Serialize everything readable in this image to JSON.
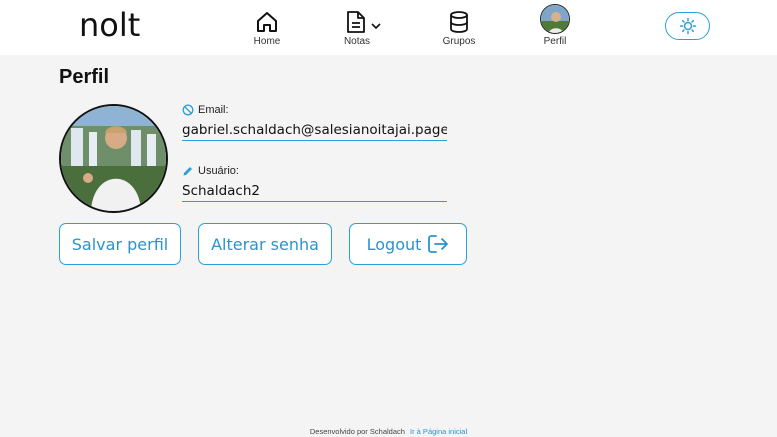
{
  "app": {
    "logo": "nolt"
  },
  "nav": {
    "items": [
      {
        "label": "Home",
        "icon": "home-icon"
      },
      {
        "label": "Notas",
        "icon": "document-icon"
      },
      {
        "label": "Grupos",
        "icon": "database-icon"
      },
      {
        "label": "Perfil",
        "icon": "avatar"
      }
    ]
  },
  "theme_toggle": {
    "icon": "sun-icon"
  },
  "page": {
    "title": "Perfil"
  },
  "profile": {
    "email": {
      "label": "Email:",
      "value": "gabriel.schaldach@salesianoitajai.page",
      "icon": "disabled-icon"
    },
    "username": {
      "label": "Usuário:",
      "value": "Schaldach2",
      "icon": "pencil-icon"
    }
  },
  "actions": {
    "save": "Salvar perfil",
    "change_password": "Alterar senha",
    "logout": "Logout"
  },
  "footer": {
    "text": "Desenvolvido por Schaldach",
    "link": "Ir à Página inicial"
  },
  "colors": {
    "accent": "#2aa0d8",
    "background": "#f4f4f4",
    "topbar": "#ffffff"
  }
}
